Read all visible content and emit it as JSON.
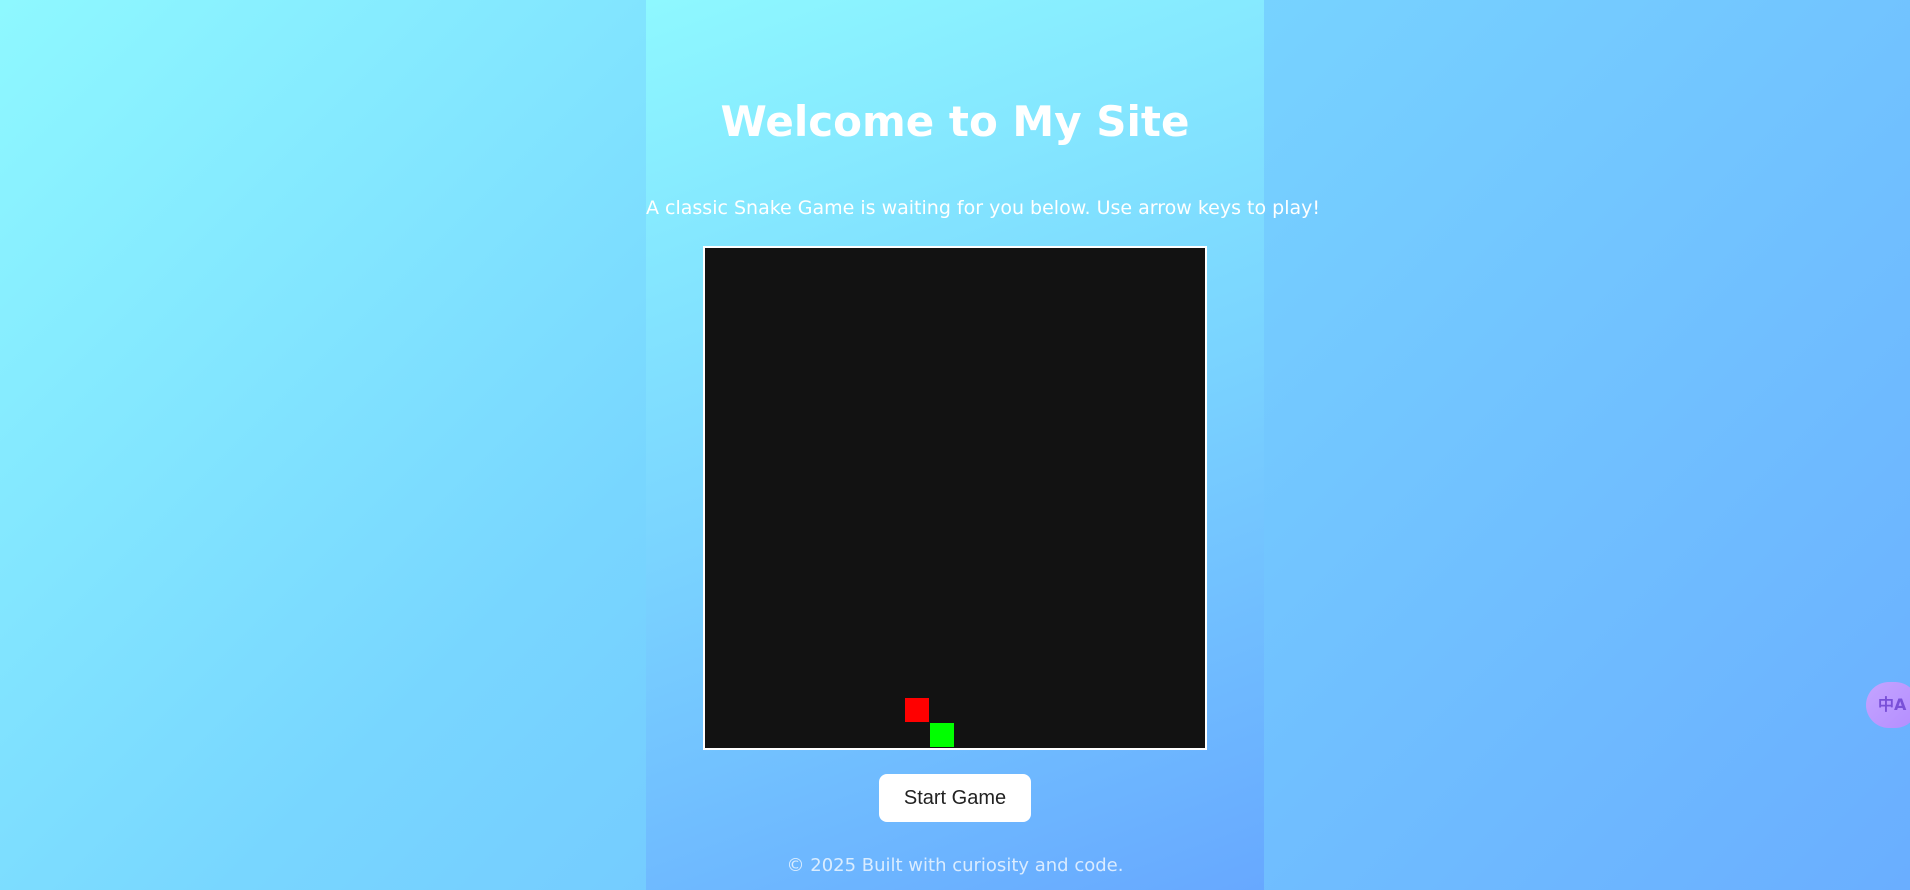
{
  "header": {
    "title": "Welcome to My Site",
    "subtitle": "A classic Snake Game is waiting for you below. Use arrow keys to play!"
  },
  "game": {
    "start_button_label": "Start Game",
    "colors": {
      "board": "#121212",
      "food": "#ff0000",
      "snake": "#00ff00"
    }
  },
  "footer": {
    "text": "© 2025 Built with curiosity and code."
  },
  "floating": {
    "translate_icon": "translate-icon",
    "translate_glyph": "中A"
  }
}
